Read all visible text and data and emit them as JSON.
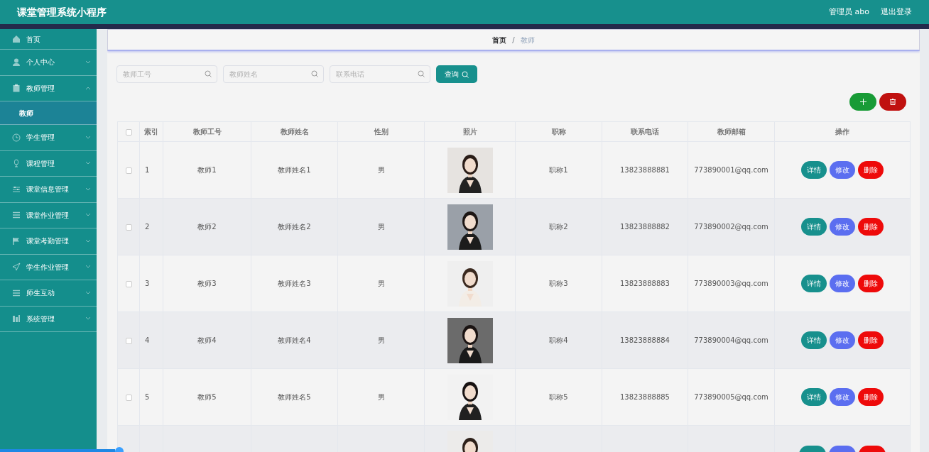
{
  "app_title": "课堂管理系统小程序",
  "user": {
    "role_label": "管理员 abo",
    "logout": "退出登录"
  },
  "sidebar": {
    "items": [
      {
        "label": "首页"
      },
      {
        "label": "个人中心",
        "expanded": false
      },
      {
        "label": "教师管理",
        "expanded": true,
        "children": [
          {
            "label": "教师",
            "selected": true
          }
        ]
      },
      {
        "label": "学生管理",
        "expanded": false
      },
      {
        "label": "课程管理",
        "expanded": false
      },
      {
        "label": "课堂信息管理",
        "expanded": false
      },
      {
        "label": "课堂作业管理",
        "expanded": false
      },
      {
        "label": "课堂考勤管理",
        "expanded": false
      },
      {
        "label": "学生作业管理",
        "expanded": false
      },
      {
        "label": "师生互动",
        "expanded": false
      },
      {
        "label": "系统管理",
        "expanded": false
      }
    ]
  },
  "breadcrumb_separator": "/",
  "breadcrumb": [
    {
      "label": "首页",
      "current": false
    },
    {
      "label": "教师",
      "current": true
    }
  ],
  "search": {
    "fields": [
      {
        "placeholder": "教师工号"
      },
      {
        "placeholder": "教师姓名"
      },
      {
        "placeholder": "联系电话"
      }
    ],
    "button": "查询"
  },
  "table": {
    "select_all_checked": false,
    "columns": [
      "索引",
      "教师工号",
      "教师姓名",
      "性别",
      "照片",
      "职称",
      "联系电话",
      "教师邮箱",
      "操作"
    ],
    "rows": [
      {
        "kind": "full",
        "checked": false,
        "index": "1",
        "teacher_id": "教师1",
        "name": "教师姓名1",
        "gender": "男",
        "title": "职称1",
        "phone": "13823888881",
        "email": "773890001@qq.com",
        "actions": [
          "详情",
          "修改",
          "删除"
        ]
      },
      {
        "kind": "full",
        "checked": false,
        "index": "2",
        "teacher_id": "教师2",
        "name": "教师姓名2",
        "gender": "男",
        "title": "职称2",
        "phone": "13823888882",
        "email": "773890002@qq.com",
        "actions": [
          "详情",
          "修改",
          "删除"
        ]
      },
      {
        "kind": "full",
        "checked": false,
        "index": "3",
        "teacher_id": "教师3",
        "name": "教师姓名3",
        "gender": "男",
        "title": "职称3",
        "phone": "13823888883",
        "email": "773890003@qq.com",
        "actions": [
          "详情",
          "修改",
          "删除"
        ]
      },
      {
        "kind": "full",
        "checked": false,
        "index": "4",
        "teacher_id": "教师4",
        "name": "教师姓名4",
        "gender": "男",
        "title": "职称4",
        "phone": "13823888884",
        "email": "773890004@qq.com",
        "actions": [
          "详情",
          "修改",
          "删除"
        ]
      },
      {
        "kind": "full",
        "checked": false,
        "index": "5",
        "teacher_id": "教师5",
        "name": "教师姓名5",
        "gender": "男",
        "title": "职称5",
        "phone": "13823888885",
        "email": "773890005@qq.com",
        "actions": [
          "详情",
          "修改",
          "删除"
        ]
      },
      {
        "kind": "partial"
      }
    ]
  }
}
